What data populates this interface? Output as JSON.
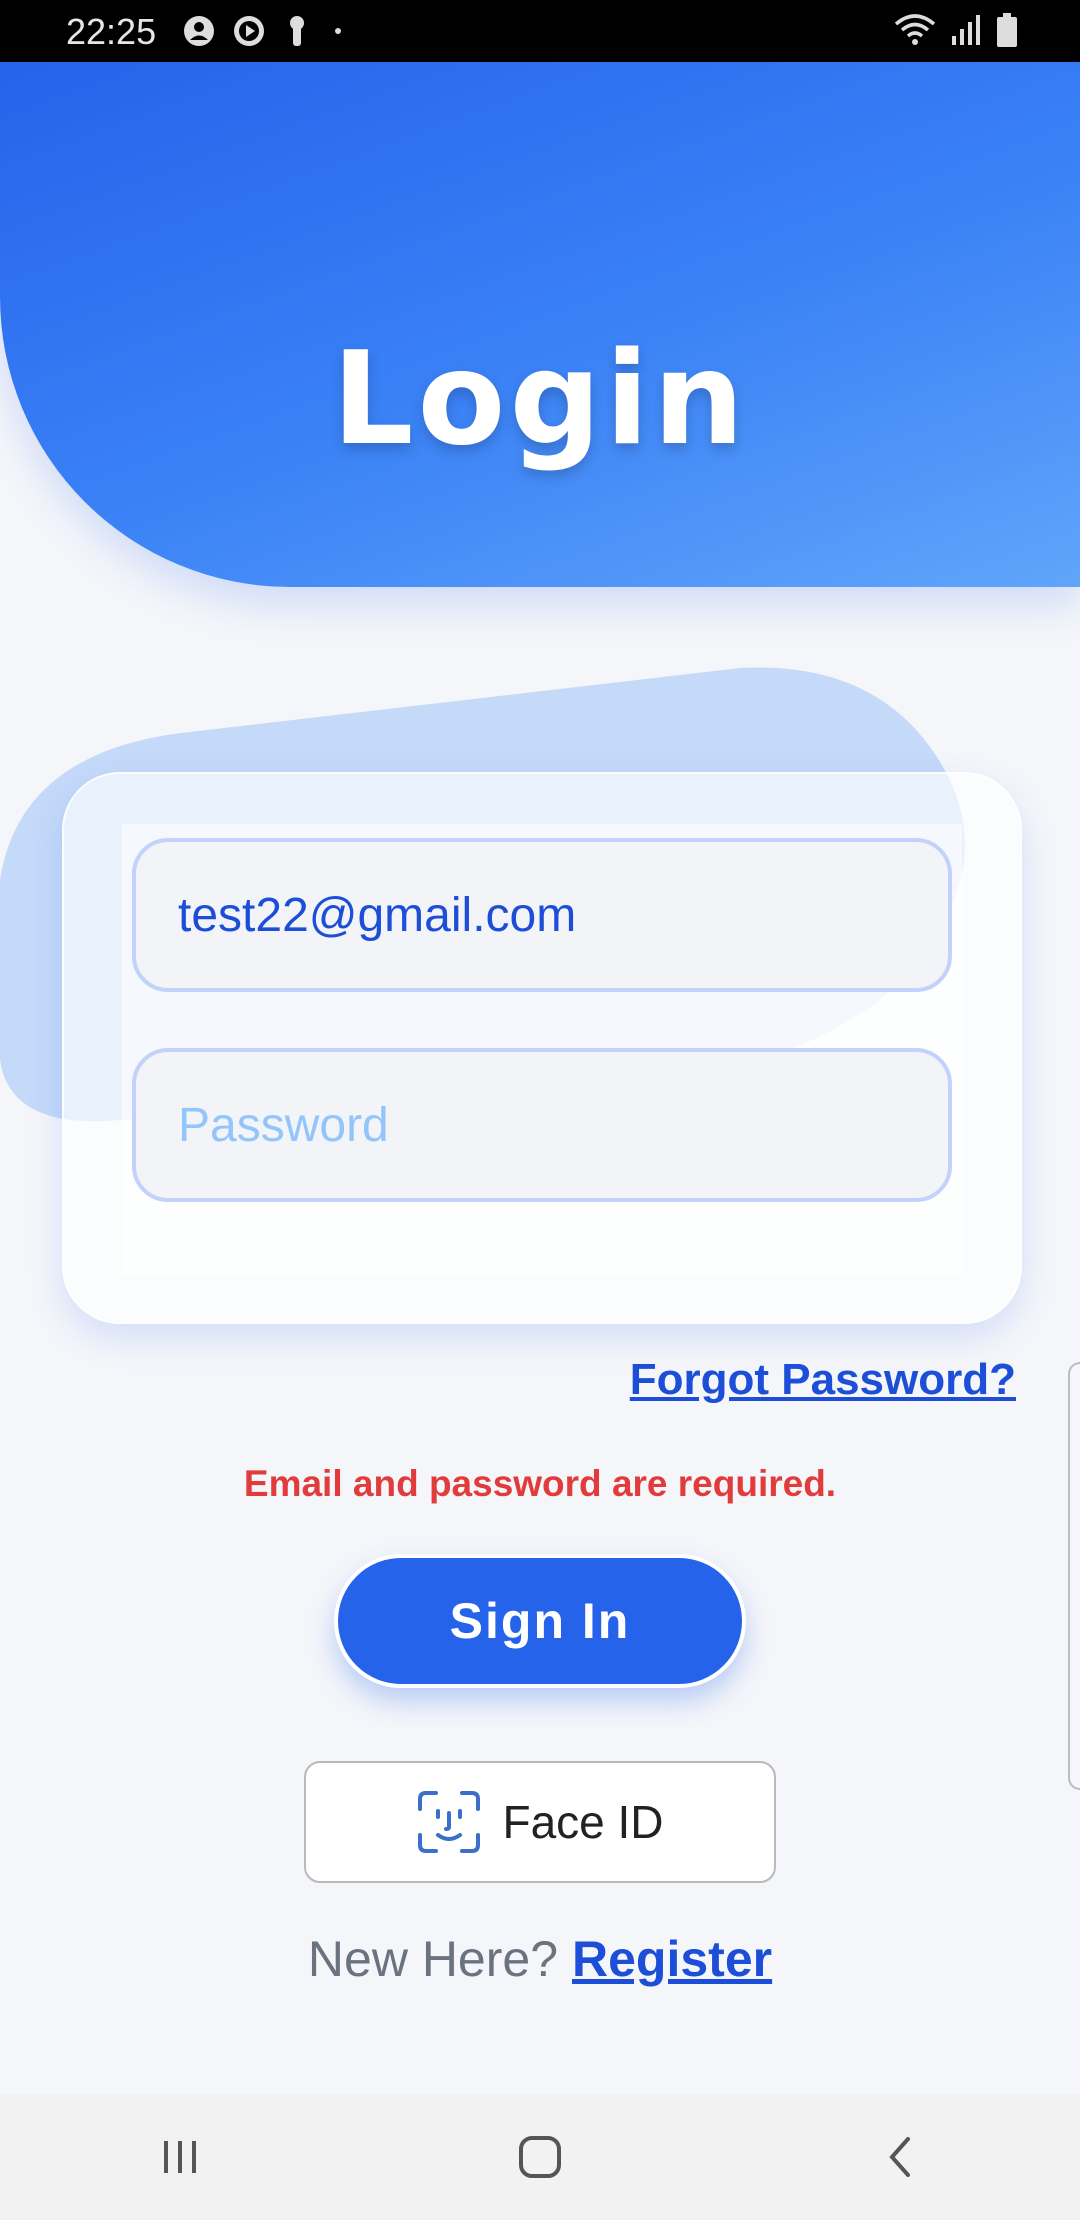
{
  "status_bar": {
    "time": "22:25",
    "left_icons": [
      "account-circle-icon",
      "play-circle-icon",
      "key-icon",
      "dot-icon"
    ],
    "right_icons": [
      "wifi-icon",
      "signal-icon",
      "battery-icon"
    ]
  },
  "header": {
    "title": "Login"
  },
  "form": {
    "email_value": "test22@gmail.com",
    "password_placeholder": "Password"
  },
  "forgot_password": "Forgot Password?",
  "error_message": "Email and password are required.",
  "sign_in_label": "Sign In",
  "face_id_label": "Face ID",
  "register": {
    "prompt": "New Here?",
    "link": "Register"
  },
  "colors": {
    "primary": "#2563eb",
    "error": "#e23b3b",
    "placeholder": "#93c5fd",
    "link": "#1d4ed8"
  },
  "nav_bar": {
    "buttons": [
      "recent-apps-icon",
      "home-icon",
      "back-icon"
    ]
  }
}
